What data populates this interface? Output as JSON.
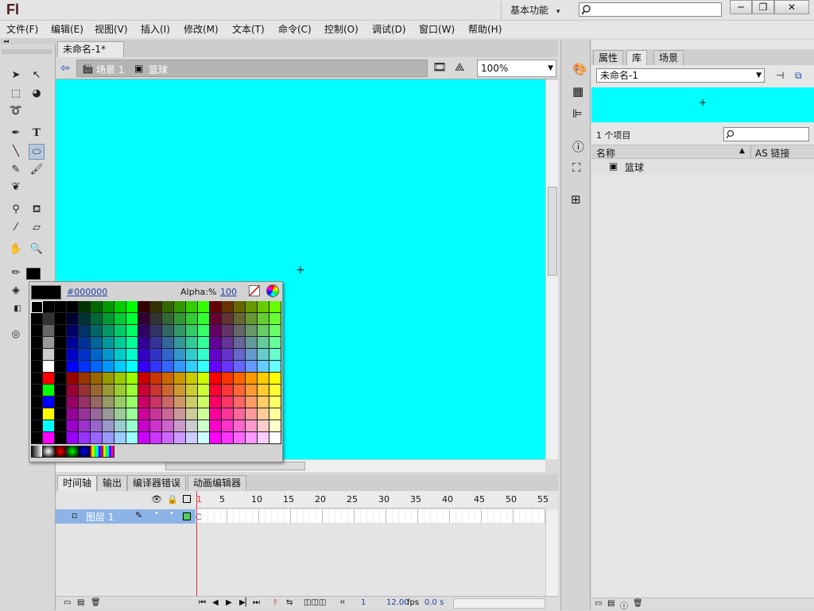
{
  "app": {
    "logo": "Fl",
    "workspace": "基本功能",
    "workspace_caret": "▾"
  },
  "window_controls": {
    "minimize": "─",
    "restore": "❐",
    "close": "✕"
  },
  "menu": [
    "文件(F)",
    "编辑(E)",
    "视图(V)",
    "插入(I)",
    "修改(M)",
    "文本(T)",
    "命令(C)",
    "控制(O)",
    "调试(D)",
    "窗口(W)",
    "帮助(H)"
  ],
  "document": {
    "tab_title": "未命名-1*",
    "tab_close": "×",
    "crumbs": [
      {
        "icon": "scene-icon",
        "label": "场景 1"
      },
      {
        "icon": "symbol-icon",
        "label": "篮球"
      }
    ],
    "zoom": "100%",
    "stage_color": "#00ffff",
    "crosshair": "+"
  },
  "color_picker": {
    "hex": "#000000",
    "alpha_label": "Alpha:%",
    "alpha_value": "100",
    "selected_color": "#000000"
  },
  "timeline": {
    "tabs": [
      "时间轴",
      "输出",
      "编译器错误",
      "动画编辑器"
    ],
    "layer_name": "图层 1",
    "frame_numbers": [
      "1",
      "5",
      "10",
      "15",
      "20",
      "25",
      "30",
      "35",
      "40",
      "45",
      "50",
      "55"
    ],
    "current_frame": "1",
    "fps": "12.00",
    "fps_unit": "fps",
    "time": "0.0 s"
  },
  "library": {
    "tabs": [
      "属性",
      "库",
      "场景"
    ],
    "active_tab": "库",
    "document": "未命名-1",
    "item_count": "1 个项目",
    "col_name": "名称",
    "col_linkage": "AS 链接",
    "items": [
      {
        "name": "篮球",
        "icon": "movieclip-icon"
      }
    ]
  },
  "colors": {
    "stage": "#00ffff",
    "layer_highlight": "#8cb4e6",
    "playhead": "#e0323c",
    "link": "#2040a0"
  }
}
